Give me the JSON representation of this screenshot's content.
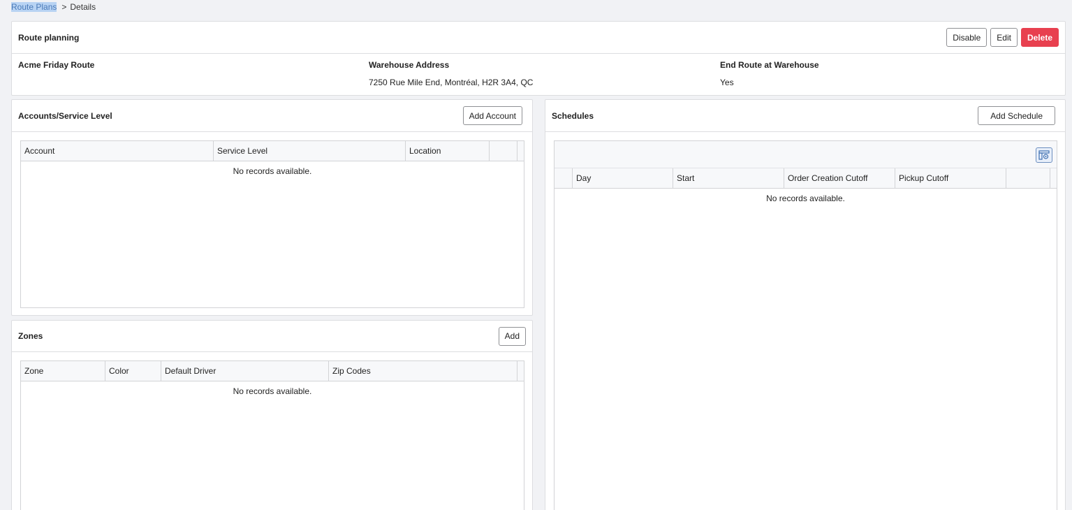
{
  "breadcrumb": {
    "parent": "Route Plans",
    "separator": ">",
    "current": "Details"
  },
  "route": {
    "title": "Route planning",
    "buttons": {
      "disable": "Disable",
      "edit": "Edit",
      "delete": "Delete"
    },
    "name": "Acme Friday Route",
    "warehouse_label": "Warehouse Address",
    "warehouse_value": "7250 Rue Mile End, Montréal, H2R 3A4, QC",
    "end_label": "End Route at Warehouse",
    "end_value": "Yes"
  },
  "accounts": {
    "title": "Accounts/Service Level",
    "add_button": "Add Account",
    "columns": [
      "Account",
      "Service Level",
      "Location"
    ],
    "empty": "No records available."
  },
  "zones": {
    "title": "Zones",
    "add_button": "Add",
    "columns": [
      "Zone",
      "Color",
      "Default Driver",
      "Zip Codes"
    ],
    "empty": "No records available."
  },
  "schedules": {
    "title": "Schedules",
    "add_button": "Add Schedule",
    "columns": [
      "Day",
      "Start",
      "Order Creation Cutoff",
      "Pickup Cutoff"
    ],
    "empty": "No records available.",
    "column_chooser_icon": "column-chooser-icon"
  },
  "colors": {
    "danger": "#e8404f",
    "highlight": "#b8d3f3",
    "link": "#4a7ab8"
  }
}
